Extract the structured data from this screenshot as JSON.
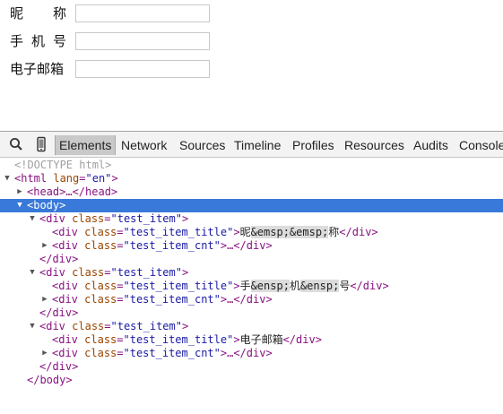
{
  "form": {
    "rows": [
      {
        "label_chars": [
          "昵",
          "称"
        ]
      },
      {
        "label_chars": [
          "手",
          "机",
          "号"
        ]
      },
      {
        "label": "电子邮箱"
      }
    ]
  },
  "devtools": {
    "tabs": [
      "Elements",
      "Network",
      "Sources",
      "Timeline",
      "Profiles",
      "Resources",
      "Audits",
      "Console"
    ],
    "active_tab": "Elements",
    "icons": [
      "search-icon",
      "device-mode-icon"
    ],
    "dom": {
      "doctype": "<!DOCTYPE html>",
      "html_open_tag": "<html",
      "html_attr": "lang",
      "html_val": "\"en\"",
      "html_close": ">",
      "head_line": "<head>…</head>",
      "body_line": "<body>",
      "div_open_a": "<div",
      "class_attr": "class",
      "item_val": "\"test_item\"",
      "title_val": "\"test_item_title\"",
      "cnt_val": "\"test_item_cnt\"",
      "gt": ">",
      "div_close": "</div>",
      "ellipsis_close": ">…</div>",
      "title_1_a": "昵",
      "title_1_ent": "&emsp;&emsp;",
      "title_1_b": "称",
      "title_2_a": "手",
      "title_2_ent1": "&ensp;",
      "title_2_b": "机",
      "title_2_ent2": "&ensp;",
      "title_2_c": "号",
      "title_3": "电子邮箱",
      "body_close": "</body>"
    }
  }
}
